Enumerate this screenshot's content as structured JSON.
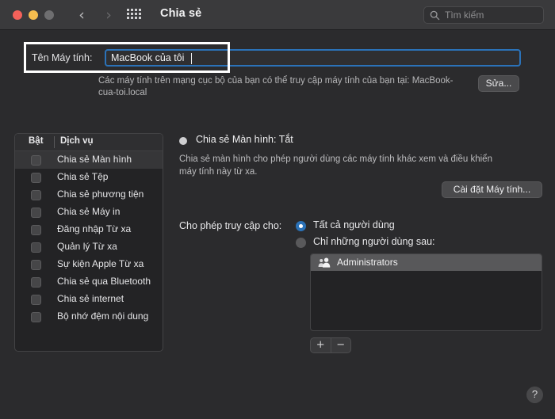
{
  "titlebar": {
    "title": "Chia sẻ",
    "back_icon": "chevron-left-icon",
    "forward_icon": "chevron-right-icon",
    "grid_icon": "grid-icon",
    "traffic_close": "close-icon",
    "traffic_minimize": "minimize-icon",
    "traffic_zoom": "zoom-icon"
  },
  "search": {
    "placeholder": "Tìm kiếm",
    "value": "",
    "icon": "search-icon"
  },
  "computer_name": {
    "label": "Tên Máy tính:",
    "value": "MacBook của tôi",
    "description": "Các máy tính trên mạng cục bộ của bạn có thể truy cập máy tính của bạn tại: MacBook-cua-toi.local",
    "edit_button": "Sửa..."
  },
  "services": {
    "header_on": "Bật",
    "header_service": "Dịch vụ",
    "items": [
      {
        "label": "Chia sẻ Màn hình",
        "checked": false,
        "selected": true
      },
      {
        "label": "Chia sẻ Tệp",
        "checked": false,
        "selected": false
      },
      {
        "label": "Chia sẻ phương tiện",
        "checked": false,
        "selected": false
      },
      {
        "label": "Chia sẻ Máy in",
        "checked": false,
        "selected": false
      },
      {
        "label": "Đăng nhập Từ xa",
        "checked": false,
        "selected": false
      },
      {
        "label": "Quản lý Từ xa",
        "checked": false,
        "selected": false
      },
      {
        "label": "Sự kiện Apple Từ xa",
        "checked": false,
        "selected": false
      },
      {
        "label": "Chia sẻ qua Bluetooth",
        "checked": false,
        "selected": false
      },
      {
        "label": "Chia sẻ internet",
        "checked": false,
        "selected": false
      },
      {
        "label": "Bộ nhớ đệm nội dung",
        "checked": false,
        "selected": false
      }
    ]
  },
  "detail": {
    "status_title": "Chia sẻ Màn hình: Tắt",
    "status_indicator": "status-dot-off",
    "description": "Chia sẻ màn hình cho phép người dùng các máy tính khác xem và điều khiển máy tính này từ xa.",
    "settings_button": "Cài đặt Máy tính...",
    "access_label": "Cho phép truy cập cho:",
    "radio_all": "Tất cả người dùng",
    "radio_only": "Chỉ những người dùng sau:",
    "radio_selected": "all",
    "users": [
      {
        "label": "Administrators",
        "icon": "users-group-icon",
        "selected": true
      }
    ],
    "add_button": "+",
    "remove_button": "−"
  },
  "help": {
    "label": "?"
  },
  "colors": {
    "window_bg": "#2b2b2d",
    "titlebar_bg": "#3a3a3c",
    "accent_blue": "#2b72b8",
    "annotation_white": "#ffffff",
    "list_bg": "#232325",
    "selected_row": "#363638"
  }
}
